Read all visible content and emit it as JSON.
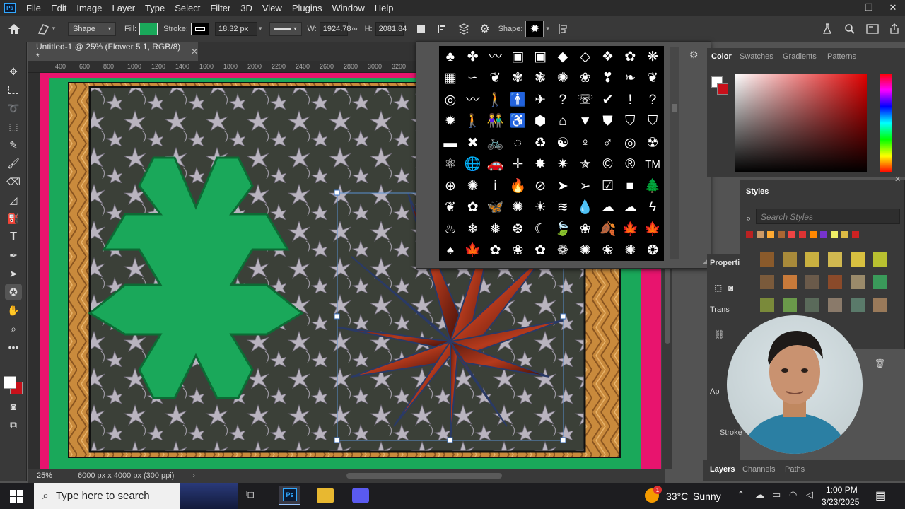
{
  "menubar": {
    "items": [
      "File",
      "Edit",
      "Image",
      "Layer",
      "Type",
      "Select",
      "Filter",
      "3D",
      "View",
      "Plugins",
      "Window",
      "Help"
    ],
    "logo": "Ps",
    "window_controls": [
      "—",
      "❐",
      "✕"
    ]
  },
  "options": {
    "mode": "Shape",
    "fill_label": "Fill:",
    "fill_color": "#1aa85a",
    "stroke_label": "Stroke:",
    "stroke_size": "18.32 px",
    "w_label": "W:",
    "w_value": "1924.78",
    "h_label": "H:",
    "h_value": "2081.84",
    "shape_label": "Shape:"
  },
  "document": {
    "tab_title": "Untitled-1 @ 25% (Flower 5 1, RGB/8) *",
    "zoom": "25%",
    "doc_size": "6000 px x 4000 px (300 ppi)",
    "ruler_ticks": [
      "400",
      "600",
      "800",
      "1000",
      "1200",
      "1400",
      "1600",
      "1800",
      "2000",
      "2200",
      "2400",
      "2600",
      "2800",
      "3000",
      "3200"
    ]
  },
  "shape_glyphs": [
    "♣",
    "✤",
    "〰",
    "▣",
    "▣",
    "◆",
    "◇",
    "❖",
    "✿",
    "❋",
    "▦",
    "∽",
    "❦",
    "✾",
    "❃",
    "✺",
    "❀",
    "❣",
    "❧",
    "❦",
    "◎",
    "〰",
    "🚶",
    "🚹",
    "✈",
    "?",
    "☏",
    "✔",
    "!",
    "?",
    "✹",
    "🚶",
    "👫",
    "♿",
    "⬢",
    "⌂",
    "▼",
    "⛊",
    "⛉",
    "⛉",
    "▬",
    "✖",
    "🚲",
    "◌",
    "♻",
    "☯",
    "♀",
    "♂",
    "◎",
    "☢",
    "⚛",
    "🌐",
    "🚗",
    "✛",
    "✸",
    "✷",
    "✯",
    "©",
    "®",
    "TM",
    "⊕",
    "✺",
    "ⅰ",
    "🔥",
    "⊘",
    "➤",
    "➢",
    "☑",
    "■",
    "🌲",
    "❦",
    "✿",
    "🦋",
    "✺",
    "☀",
    "≋",
    "💧",
    "☁",
    "☁",
    "ϟ",
    "♨",
    "❄",
    "❅",
    "❆",
    "☾",
    "🍃",
    "❀",
    "🍂",
    "🍁",
    "🍁",
    "♠",
    "🍁",
    "✿",
    "❀",
    "✿",
    "❁",
    "✺",
    "❀",
    "✺",
    "❂"
  ],
  "panels": {
    "color_tabs": [
      "Color",
      "Swatches",
      "Gradients",
      "Patterns"
    ],
    "styles_title": "Styles",
    "search_placeholder": "Search Styles",
    "properties_title": "Properti",
    "transform_label": "Trans",
    "appearance_label": "Ap",
    "stroke_label": "Stroke",
    "layers_tabs": [
      "Layers",
      "Channels",
      "Paths"
    ]
  },
  "taskbar": {
    "search_placeholder": "Type here to search",
    "weather_temp": "33°C",
    "weather_desc": "Sunny",
    "time": "1:00 PM",
    "date": "3/23/2025",
    "weather_badge": "1"
  },
  "colors": {
    "accent_blue": "#31a8ff",
    "shape_green": "#1aa85a",
    "canvas_pink": "#e8146e",
    "fg_swatch": "#ffffff",
    "bg_swatch": "#c8101a"
  }
}
